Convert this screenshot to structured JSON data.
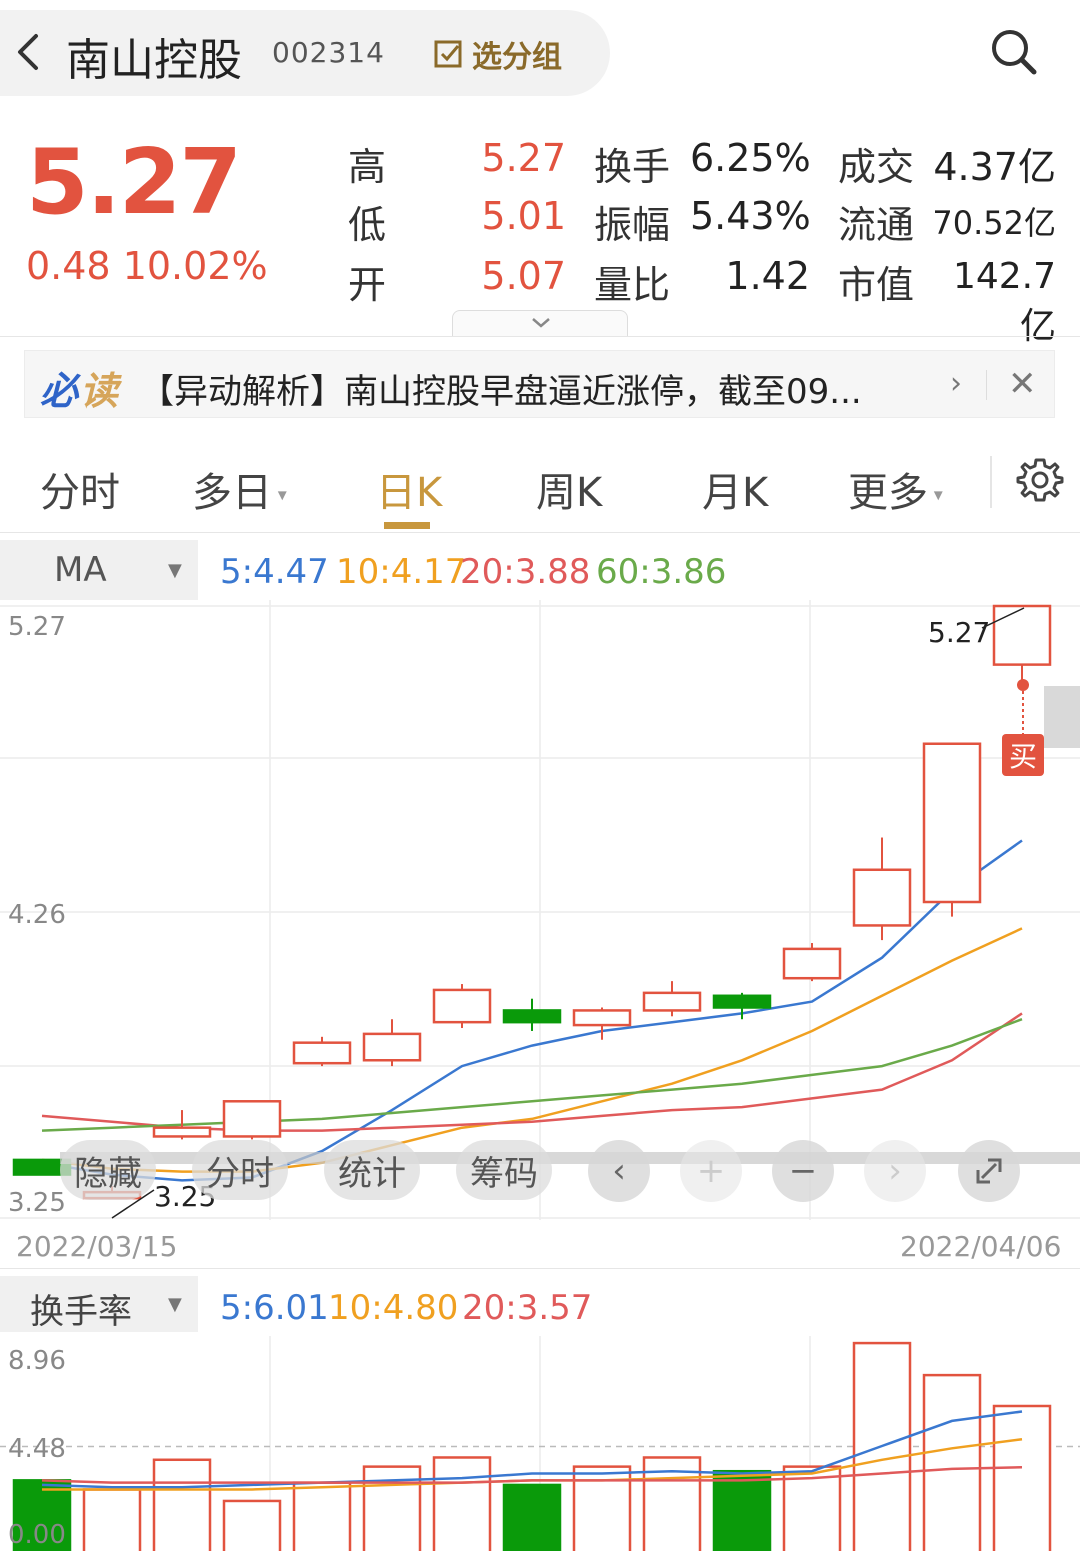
{
  "header": {
    "stock_name": "南山控股",
    "stock_code": "002314",
    "group_label": "选分组"
  },
  "quote": {
    "price": "5.27",
    "change": "0.48",
    "change_pct": "10.02%",
    "rows": [
      {
        "k1": "高",
        "v1": "5.27",
        "k2": "换手",
        "v2": "6.25%",
        "k3": "成交",
        "v3": "4.37亿"
      },
      {
        "k1": "低",
        "v1": "5.01",
        "k2": "振幅",
        "v2": "5.43%",
        "k3": "流通",
        "v3": "70.52亿"
      },
      {
        "k1": "开",
        "v1": "5.07",
        "k2": "量比",
        "v2": "1.42",
        "k3": "市值",
        "v3": "142.7亿"
      }
    ]
  },
  "news": {
    "tag_a": "必",
    "tag_b": "读",
    "headline": "【异动解析】南山控股早盘逼近涨停，截至09..."
  },
  "tabs": [
    {
      "label": "分时"
    },
    {
      "label": "多日"
    },
    {
      "label": "日K"
    },
    {
      "label": "周K"
    },
    {
      "label": "月K"
    },
    {
      "label": "更多"
    }
  ],
  "colors": {
    "up": "#e2533f",
    "down": "#0a9a0a",
    "ma5": "#3a78d0",
    "ma10": "#f0a020",
    "ma20": "#e05a5a",
    "ma60": "#6aaa4a",
    "accent": "#c8973d"
  },
  "ma": {
    "selector": "MA",
    "ma5": "5:4.47",
    "ma10": "10:4.17",
    "ma20": "20:3.88",
    "ma60": "60:3.86"
  },
  "kline": {
    "y_top": "5.27",
    "y_mid": "4.26",
    "y_bottom": "3.25",
    "high_marker": "5.27",
    "low_marker": "3.25",
    "buy_tag": "买",
    "date_start": "2022/03/15",
    "date_end": "2022/04/06"
  },
  "overlay_buttons": {
    "hide": "隐藏",
    "timeshare": "分时",
    "stats": "统计",
    "chips": "筹码"
  },
  "turnover": {
    "selector": "换手率",
    "ma5": "5:6.01",
    "ma10": "10:4.80",
    "ma20": "20:3.57",
    "y_top": "8.96",
    "y_mid": "4.48",
    "y_bottom": "0.00"
  },
  "chart_data": [
    {
      "type": "candlestick",
      "title": "",
      "x": [
        "2022/03/15",
        "",
        "",
        "",
        "",
        "",
        "",
        "",
        "",
        "",
        "",
        "",
        "",
        "",
        "2022/04/06"
      ],
      "candles": [
        {
          "open": 3.38,
          "close": 3.33,
          "high": 3.37,
          "low": 3.33
        },
        {
          "open": 3.26,
          "close": 3.27,
          "high": 3.29,
          "low": 3.25
        },
        {
          "open": 3.46,
          "close": 3.49,
          "high": 3.55,
          "low": 3.45
        },
        {
          "open": 3.46,
          "close": 3.58,
          "high": 3.58,
          "low": 3.45
        },
        {
          "open": 3.71,
          "close": 3.78,
          "high": 3.8,
          "low": 3.7
        },
        {
          "open": 3.72,
          "close": 3.81,
          "high": 3.86,
          "low": 3.7
        },
        {
          "open": 3.85,
          "close": 3.96,
          "high": 3.98,
          "low": 3.83
        },
        {
          "open": 3.89,
          "close": 3.85,
          "high": 3.93,
          "low": 3.82
        },
        {
          "open": 3.84,
          "close": 3.89,
          "high": 3.9,
          "low": 3.79
        },
        {
          "open": 3.89,
          "close": 3.95,
          "high": 3.99,
          "low": 3.87
        },
        {
          "open": 3.94,
          "close": 3.9,
          "high": 3.95,
          "low": 3.86
        },
        {
          "open": 4.0,
          "close": 4.1,
          "high": 4.12,
          "low": 3.99
        },
        {
          "open": 4.18,
          "close": 4.37,
          "high": 4.48,
          "low": 4.13
        },
        {
          "open": 4.26,
          "close": 4.8,
          "high": 4.8,
          "low": 4.21
        },
        {
          "open": 5.07,
          "close": 5.27,
          "high": 5.27,
          "low": 5.01
        }
      ],
      "series": [
        {
          "name": "MA5",
          "values": [
            3.37,
            3.33,
            3.31,
            3.32,
            3.41,
            3.55,
            3.7,
            3.77,
            3.82,
            3.85,
            3.88,
            3.92,
            4.07,
            4.3,
            4.47
          ]
        },
        {
          "name": "MA10",
          "values": [
            3.38,
            3.35,
            3.34,
            3.34,
            3.37,
            3.43,
            3.49,
            3.52,
            3.58,
            3.64,
            3.72,
            3.82,
            3.94,
            4.06,
            4.17
          ]
        },
        {
          "name": "MA20",
          "values": [
            3.53,
            3.51,
            3.49,
            3.48,
            3.48,
            3.49,
            3.5,
            3.51,
            3.53,
            3.55,
            3.56,
            3.59,
            3.62,
            3.72,
            3.88
          ]
        },
        {
          "name": "MA60",
          "values": [
            3.48,
            3.49,
            3.5,
            3.51,
            3.52,
            3.54,
            3.56,
            3.58,
            3.6,
            3.62,
            3.64,
            3.67,
            3.7,
            3.77,
            3.86
          ]
        }
      ],
      "ylim": [
        3.25,
        5.27
      ]
    },
    {
      "type": "bar",
      "title": "",
      "categories": [
        "2022/03/15",
        "",
        "",
        "",
        "",
        "",
        "",
        "",
        "",
        "",
        "",
        "",
        "",
        "",
        "2022/04/06"
      ],
      "values": [
        3.0,
        2.6,
        3.9,
        2.1,
        2.9,
        3.6,
        4.0,
        2.8,
        3.6,
        4.0,
        3.4,
        3.6,
        9.0,
        7.6,
        6.25
      ],
      "series": [
        {
          "name": "MA5",
          "values": [
            2.8,
            2.7,
            2.7,
            2.8,
            2.9,
            3.0,
            3.1,
            3.3,
            3.3,
            3.4,
            3.3,
            3.4,
            4.5,
            5.6,
            6.01
          ]
        },
        {
          "name": "MA10",
          "values": [
            2.6,
            2.6,
            2.6,
            2.6,
            2.7,
            2.8,
            2.9,
            3.0,
            3.0,
            3.1,
            3.2,
            3.3,
            3.9,
            4.4,
            4.8
          ]
        },
        {
          "name": "MA20",
          "values": [
            3.0,
            2.9,
            2.9,
            2.9,
            2.9,
            2.9,
            2.9,
            3.0,
            3.0,
            3.0,
            3.0,
            3.1,
            3.3,
            3.5,
            3.57
          ]
        }
      ],
      "ylim": [
        0,
        8.96
      ]
    }
  ]
}
